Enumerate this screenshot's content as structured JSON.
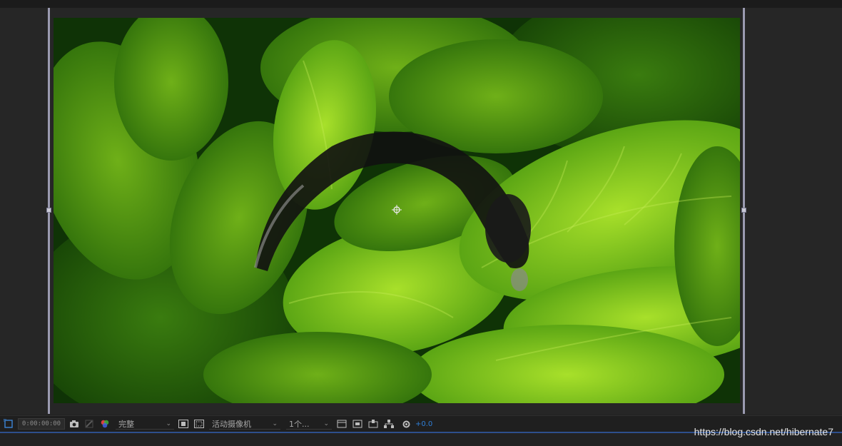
{
  "viewer": {
    "frame_description_icon": "composition-frame",
    "anchor_icon": "anchor-point-icon"
  },
  "toolbar": {
    "timecode": "0:00:00:00",
    "resolution": "完整",
    "camera": "活动摄像机",
    "views": "1个...",
    "exposure": "+0.0",
    "icons": [
      "region-of-interest-icon",
      "camera-snapshot-icon",
      "show-snapshot-icon",
      "color-channel-icon",
      "transparency-grid-icon",
      "mask-toggle-icon",
      "view-layout-icon",
      "3d-view-icon",
      "pixel-aspect-icon",
      "flowchart-icon",
      "reset-exposure-icon"
    ]
  },
  "watermark": "https://blog.csdn.net/hibernate7",
  "colors": {
    "accent_blue": "#2f7fd8",
    "panel_bg": "#232323",
    "guide_line": "#9a9ab0"
  }
}
